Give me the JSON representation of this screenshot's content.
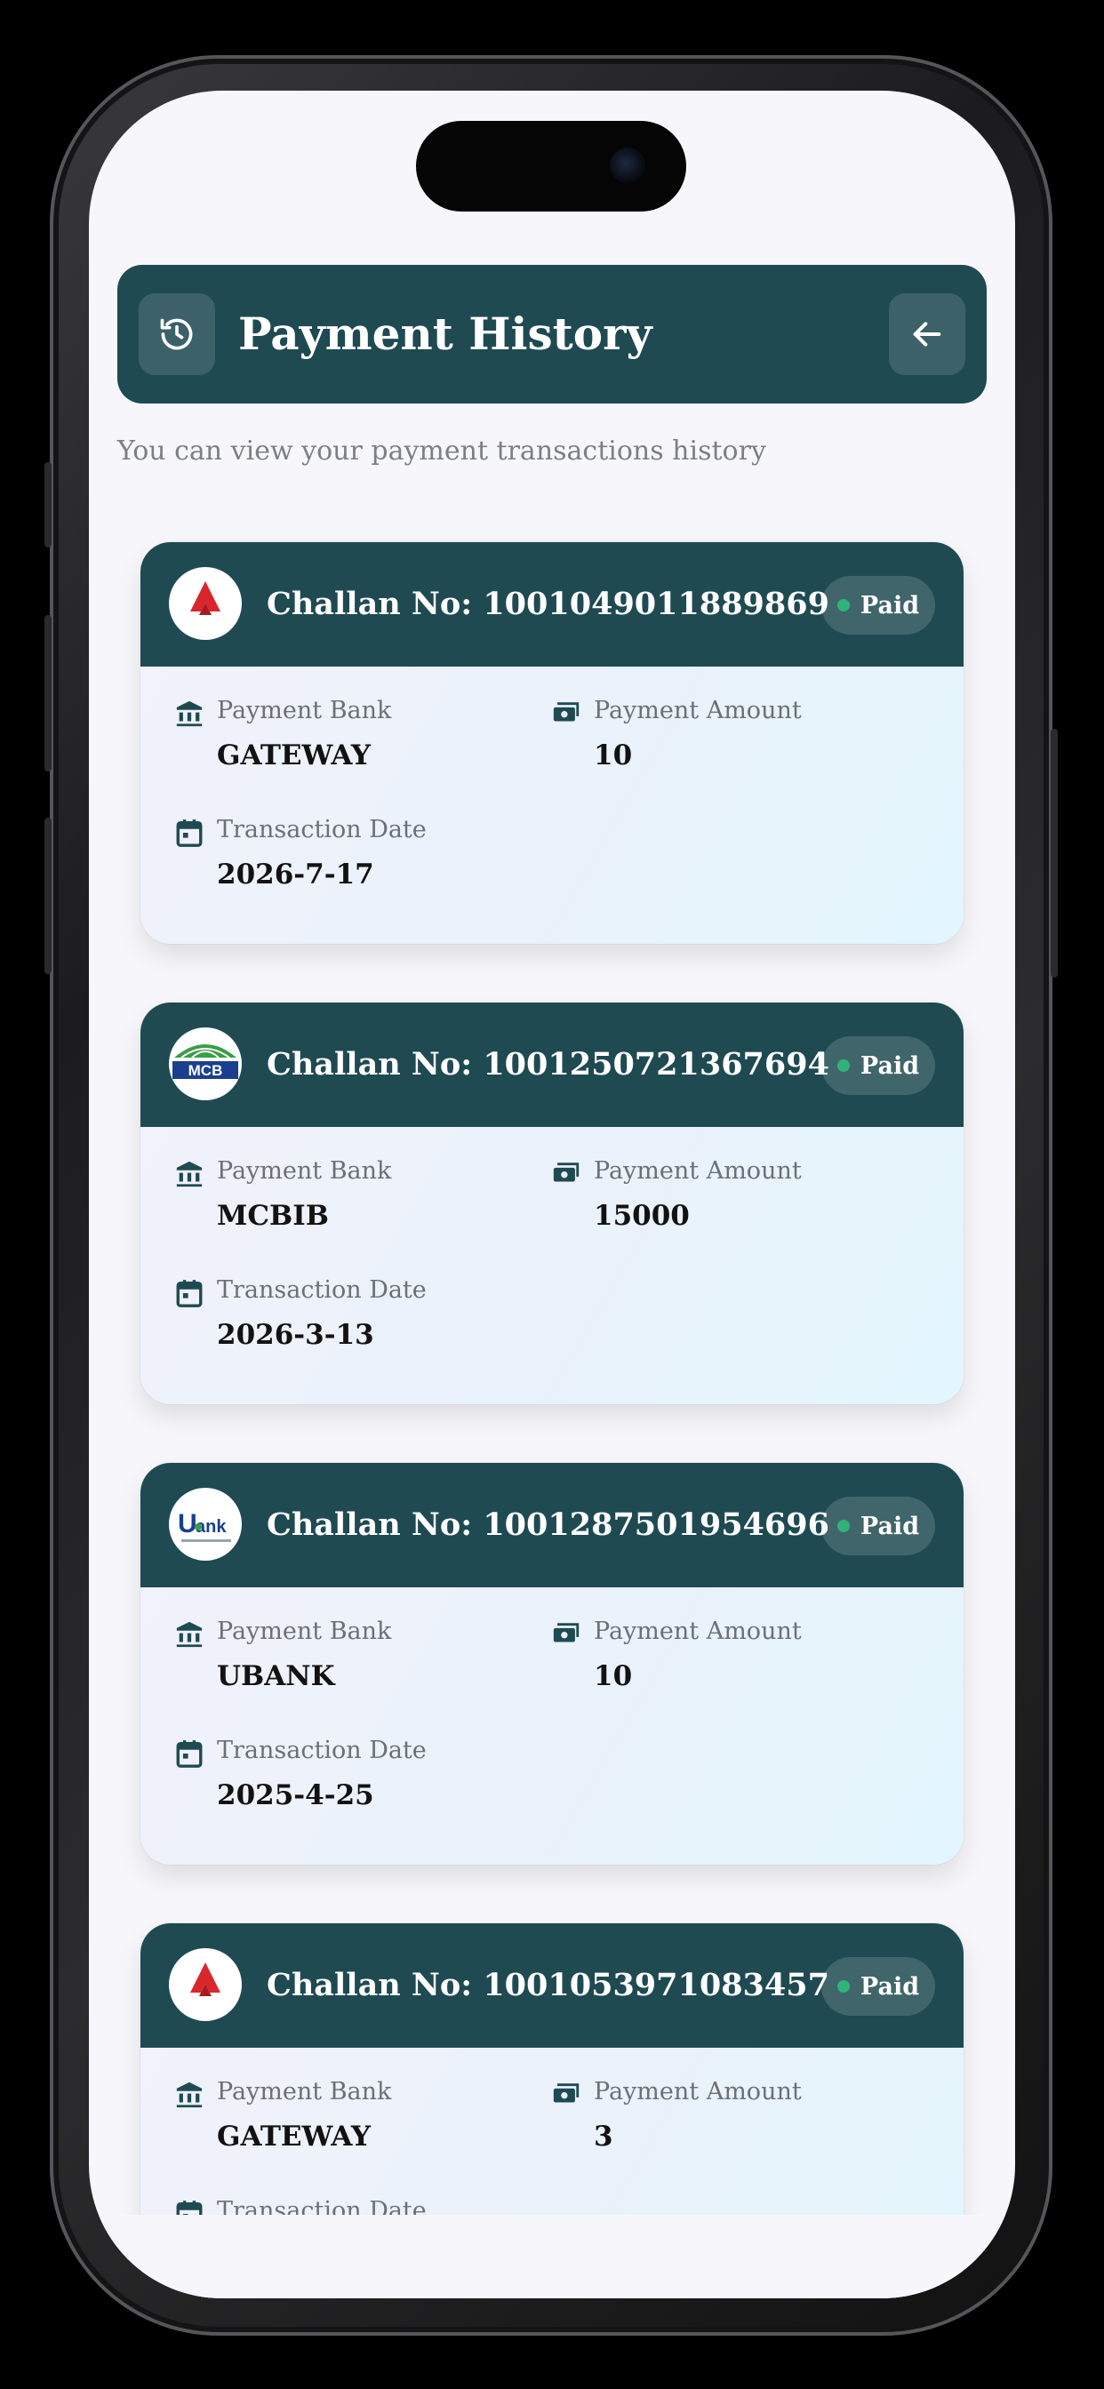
{
  "header": {
    "title": "Payment History",
    "history_icon": "history-icon",
    "back_icon": "arrow-left-icon"
  },
  "subtitle": "You can view your payment transactions history",
  "labels": {
    "bank": "Payment Bank",
    "amount": "Payment Amount",
    "date": "Transaction Date"
  },
  "transactions": [
    {
      "challan": "Challan No: 1001049011889869",
      "status": "Paid",
      "bank": "GATEWAY",
      "amount": "10",
      "date": "2026-7-17",
      "logo": "bank-alfalah-logo"
    },
    {
      "challan": "Challan No: 1001250721367694",
      "status": "Paid",
      "bank": "MCBIB",
      "amount": "15000",
      "date": "2026-3-13",
      "logo": "mcb-islamic-logo"
    },
    {
      "challan": "Challan No: 1001287501954696",
      "status": "Paid",
      "bank": "UBANK",
      "amount": "10",
      "date": "2025-4-25",
      "logo": "ubank-logo"
    },
    {
      "challan": "Challan No: 1001053971083457",
      "status": "Paid",
      "bank": "GATEWAY",
      "amount": "3",
      "date": "",
      "logo": "bank-alfalah-logo"
    }
  ],
  "colors": {
    "primary": "#1f4a52",
    "paid_dot": "#2fb37a",
    "background": "#f7f7fb"
  }
}
